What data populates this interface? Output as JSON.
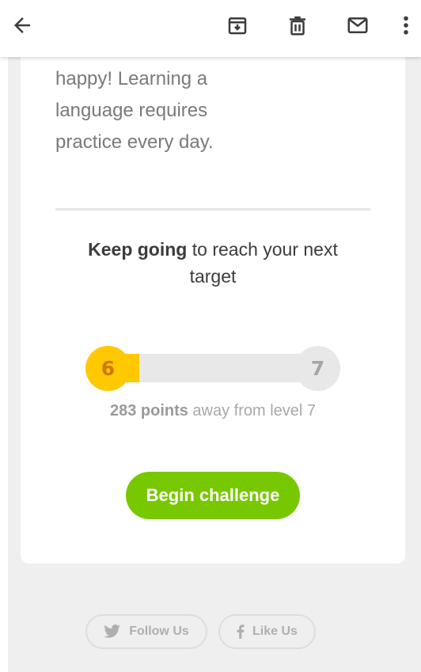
{
  "toolbar": {
    "back_icon": "arrow-left-icon",
    "archive_icon": "archive-icon",
    "delete_icon": "trash-icon",
    "mail_icon": "mail-icon",
    "more_icon": "more-vertical-icon"
  },
  "email": {
    "intro_lines": [
      "happy! Learning a",
      "language requires",
      "practice every day."
    ],
    "headline_bold": "Keep going",
    "headline_rest": " to reach your next target",
    "progress": {
      "current_level": "6",
      "next_level": "7",
      "fraction": 0.15,
      "points_bold": "283 points",
      "points_rest": " away from level 7"
    },
    "cta_label": "Begin challenge"
  },
  "footer": {
    "follow_label": "Follow Us",
    "like_label": "Like Us",
    "follow_icon": "twitter-icon",
    "like_icon": "facebook-icon"
  },
  "colors": {
    "accent_green": "#78c800",
    "level_yellow": "#ffc800",
    "level_text": "#cd7900"
  }
}
